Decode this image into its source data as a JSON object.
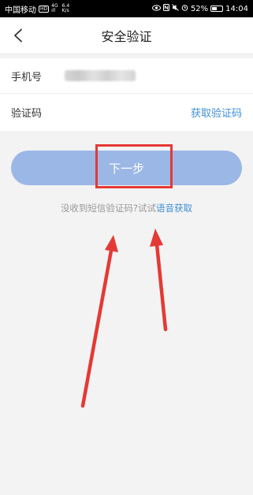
{
  "status_bar": {
    "carrier": "中国移动",
    "badge": "HD",
    "network": [
      "4G",
      "ıll"
    ],
    "speed": [
      "6.4",
      "K/s"
    ],
    "battery": "52%",
    "battery_level": 0.52,
    "time": "14:04"
  },
  "nav": {
    "title": "安全验证"
  },
  "form": {
    "phone_label": "手机号",
    "code_label": "验证码",
    "get_code_label": "获取验证码"
  },
  "next_button": {
    "label": "下一步"
  },
  "hint": {
    "text": "没收到短信验证码?试试",
    "link": "语音获取"
  },
  "colors": {
    "accent": "#3e8fd6",
    "button": "#9bb7e6",
    "annotation": "#e53935"
  }
}
